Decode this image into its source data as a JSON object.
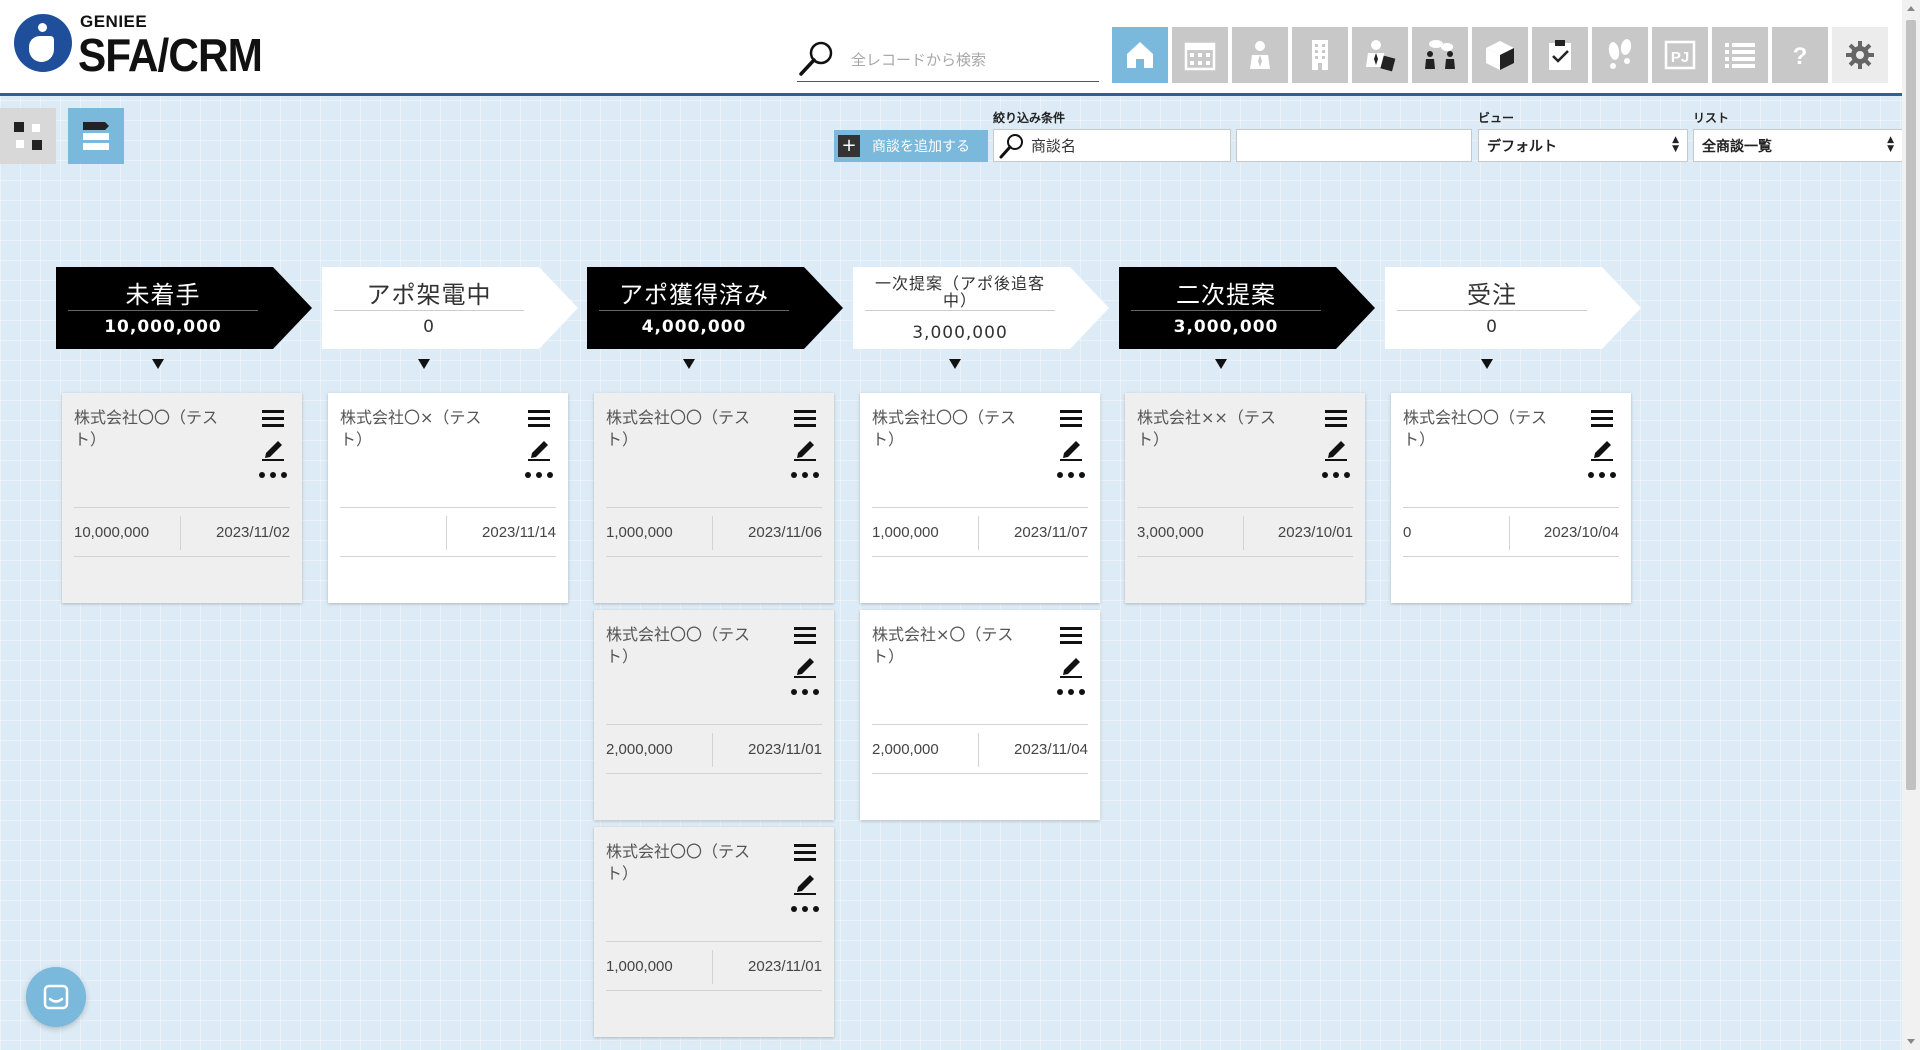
{
  "header": {
    "logo_small": "GENIEE",
    "logo_big": "SFA/CRM",
    "search_placeholder": "全レコードから検索",
    "nav_icons": [
      {
        "name": "home-icon",
        "active": true
      },
      {
        "name": "calendar-icon"
      },
      {
        "name": "contact-person-icon"
      },
      {
        "name": "building-icon"
      },
      {
        "name": "deal-person-icon"
      },
      {
        "name": "meeting-icon"
      },
      {
        "name": "product-box-icon"
      },
      {
        "name": "task-clipboard-icon"
      },
      {
        "name": "footprint-icon"
      },
      {
        "name": "project-pj-icon",
        "label": "PJ"
      },
      {
        "name": "list-icon"
      },
      {
        "name": "help-icon",
        "label": "?"
      },
      {
        "name": "settings-gear-icon"
      }
    ]
  },
  "toolbar": {
    "add_button": "商談を追加する",
    "filter_label": "絞り込み条件",
    "filter_value": "商談名",
    "filter_value2": "",
    "view_label": "ビュー",
    "view_value": "デフォルト",
    "list_label": "リスト",
    "list_value": "全商談一覧"
  },
  "stages": [
    {
      "name": "未着手",
      "amount": "10,000,000",
      "style": "dark"
    },
    {
      "name": "アポ架電中",
      "amount": "0",
      "style": "light"
    },
    {
      "name": "アポ獲得済み",
      "amount": "4,000,000",
      "style": "dark"
    },
    {
      "name": "一次提案（アポ後追客中）",
      "amount": "3,000,000",
      "style": "light"
    },
    {
      "name": "二次提案",
      "amount": "3,000,000",
      "style": "dark"
    },
    {
      "name": "受注",
      "amount": "0",
      "style": "light"
    }
  ],
  "cards": [
    {
      "stage": 0,
      "company": "株式会社〇〇（テスト）",
      "amount": "10,000,000",
      "date": "2023/11/02"
    },
    {
      "stage": 1,
      "company": "株式会社〇×（テスト）",
      "amount": "",
      "date": "2023/11/14"
    },
    {
      "stage": 2,
      "company": "株式会社〇〇（テスト）",
      "amount": "1,000,000",
      "date": "2023/11/06"
    },
    {
      "stage": 2,
      "company": "株式会社〇〇（テスト）",
      "amount": "2,000,000",
      "date": "2023/11/01"
    },
    {
      "stage": 2,
      "company": "株式会社〇〇（テスト）",
      "amount": "1,000,000",
      "date": "2023/11/01"
    },
    {
      "stage": 3,
      "company": "株式会社〇〇（テスト）",
      "amount": "1,000,000",
      "date": "2023/11/07"
    },
    {
      "stage": 3,
      "company": "株式会社×〇（テスト）",
      "amount": "2,000,000",
      "date": "2023/11/04"
    },
    {
      "stage": 4,
      "company": "株式会社××（テスト）",
      "amount": "3,000,000",
      "date": "2023/10/01"
    },
    {
      "stage": 5,
      "company": "株式会社〇〇（テスト）",
      "amount": "0",
      "date": "2023/10/04"
    }
  ]
}
